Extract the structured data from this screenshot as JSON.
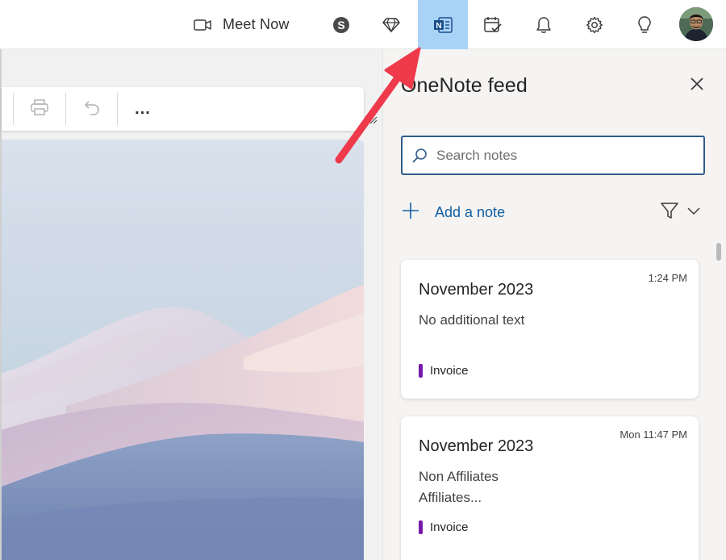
{
  "topbar": {
    "meet_now_label": "Meet Now",
    "icons": [
      "video-camera-icon",
      "skype-icon",
      "diamond-icon",
      "onenote-icon",
      "calendar-check-icon",
      "bell-icon",
      "gear-icon",
      "lightbulb-icon"
    ],
    "active_icon": "onenote-icon",
    "active_color": "#a9d2f7"
  },
  "toolbar": {
    "icons": [
      "print-icon",
      "undo-icon"
    ],
    "more_label": "..."
  },
  "panel": {
    "title": "OneNote feed",
    "search_placeholder": "Search notes",
    "add_note_label": "Add a note",
    "accent_color": "#115ea3"
  },
  "notes": [
    {
      "title": "November 2023",
      "time": "1:24 PM",
      "body_lines": [
        "No additional text"
      ],
      "tag": "Invoice",
      "tag_color": "#7719aa"
    },
    {
      "title": "November 2023",
      "time": "Mon 11:47 PM",
      "body_lines": [
        "Non Affiliates",
        "Affiliates..."
      ],
      "tag": "Invoice",
      "tag_color": "#7719aa"
    }
  ],
  "annotation": {
    "arrow_color": "#ee3a4a"
  }
}
